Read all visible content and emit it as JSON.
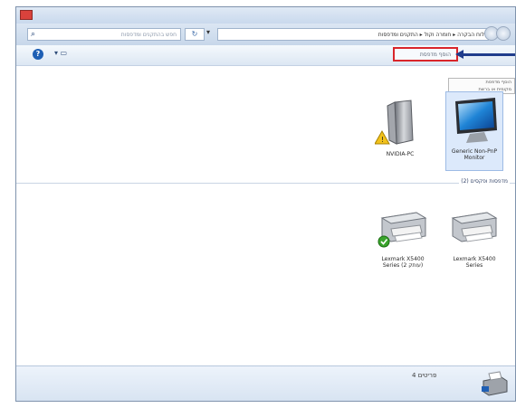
{
  "window": {
    "title": "",
    "colors": {
      "accent": "#1f3c8c",
      "highlight": "#d9252a",
      "selection": "#dce9fb"
    }
  },
  "addressbar": {
    "search_placeholder": "חפש בהתקנים ומדפסות",
    "breadcrumb": "לוח הבקרה ▸ חומרה וקול ▸ התקנים ומדפסות"
  },
  "toolbar": {
    "add_printer_label": "הוסף מדפסת"
  },
  "tooltip": {
    "line1": "הוסף מדפסת",
    "line2": "מקומית או ברשת"
  },
  "devices": [
    {
      "label_line1": "NVIDIA-PC",
      "label_line2": "",
      "icon": "computer-tower-icon",
      "status": "warning"
    },
    {
      "label_line1": "Generic Non-PnP",
      "label_line2": "Monitor",
      "icon": "monitor-icon",
      "status": "selected"
    }
  ],
  "printers_group": {
    "header": "מדפסות ופקסים (2)"
  },
  "printers": [
    {
      "label_line1": "Lexmark X5400",
      "label_line2": "Series (2 עותק)",
      "icon": "printer-icon",
      "default": true
    },
    {
      "label_line1": "Lexmark X5400",
      "label_line2": "Series",
      "icon": "printer-icon",
      "default": false
    }
  ],
  "details": {
    "count": "4 פריטים",
    "icon": "printer-fax-icon"
  }
}
